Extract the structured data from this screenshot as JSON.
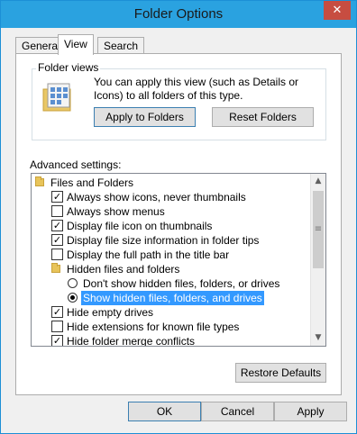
{
  "window": {
    "title": "Folder Options",
    "close_glyph": "✕"
  },
  "tabs": [
    {
      "label": "General",
      "active": false
    },
    {
      "label": "View",
      "active": true
    },
    {
      "label": "Search",
      "active": false
    }
  ],
  "folder_views": {
    "title": "Folder views",
    "description": "You can apply this view (such as Details or Icons) to all folders of this type.",
    "apply_button": "Apply to Folders",
    "reset_button": "Reset Folders"
  },
  "advanced": {
    "label": "Advanced settings:",
    "items": [
      {
        "kind": "folder",
        "indent": 0,
        "text": "Files and Folders"
      },
      {
        "kind": "checkbox",
        "indent": 1,
        "checked": true,
        "text": "Always show icons, never thumbnails"
      },
      {
        "kind": "checkbox",
        "indent": 1,
        "checked": false,
        "text": "Always show menus"
      },
      {
        "kind": "checkbox",
        "indent": 1,
        "checked": true,
        "text": "Display file icon on thumbnails"
      },
      {
        "kind": "checkbox",
        "indent": 1,
        "checked": true,
        "text": "Display file size information in folder tips"
      },
      {
        "kind": "checkbox",
        "indent": 1,
        "checked": false,
        "text": "Display the full path in the title bar"
      },
      {
        "kind": "folder",
        "indent": 1,
        "text": "Hidden files and folders"
      },
      {
        "kind": "radio",
        "indent": 2,
        "checked": false,
        "text": "Don't show hidden files, folders, or drives"
      },
      {
        "kind": "radio",
        "indent": 2,
        "checked": true,
        "selected": true,
        "text": "Show hidden files, folders, and drives"
      },
      {
        "kind": "checkbox",
        "indent": 1,
        "checked": true,
        "text": "Hide empty drives"
      },
      {
        "kind": "checkbox",
        "indent": 1,
        "checked": false,
        "text": "Hide extensions for known file types"
      },
      {
        "kind": "checkbox",
        "indent": 1,
        "checked": true,
        "text": "Hide folder merge conflicts"
      }
    ]
  },
  "restore_button": "Restore Defaults",
  "footer": {
    "ok": "OK",
    "cancel": "Cancel",
    "apply": "Apply"
  },
  "colors": {
    "titlebar": "#2aa2e0",
    "close": "#c74d41",
    "selection": "#3399ff"
  }
}
